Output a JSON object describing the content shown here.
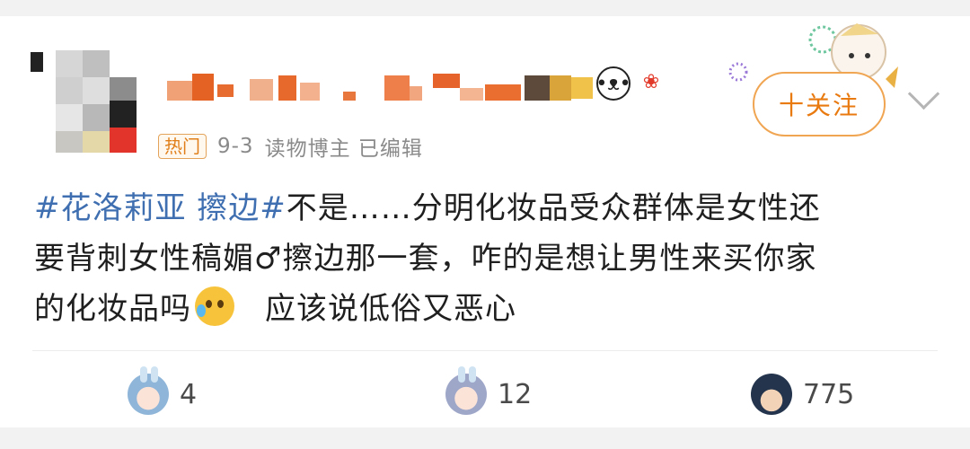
{
  "post": {
    "hot_label": "热门",
    "date": "9-3",
    "source": "读物博主 已编辑",
    "follow_label": "十关注",
    "hashtag": "#花洛莉亚 擦边#",
    "line1_rest": "不是……分明化妆品受众群体是女性还",
    "line2": "要背刺女性稿媚♂擦边那一套，咋的是想让男性来买你家",
    "line3_a": "的化妆品吗",
    "line3_b": "应该说低俗又恶心"
  },
  "actions": {
    "share_count": "4",
    "comment_count": "12",
    "like_count": "775"
  },
  "colors": {
    "hashtag": "#3f6fb0",
    "follow": "#e87a10",
    "hot_tag": "#e07f1a"
  }
}
